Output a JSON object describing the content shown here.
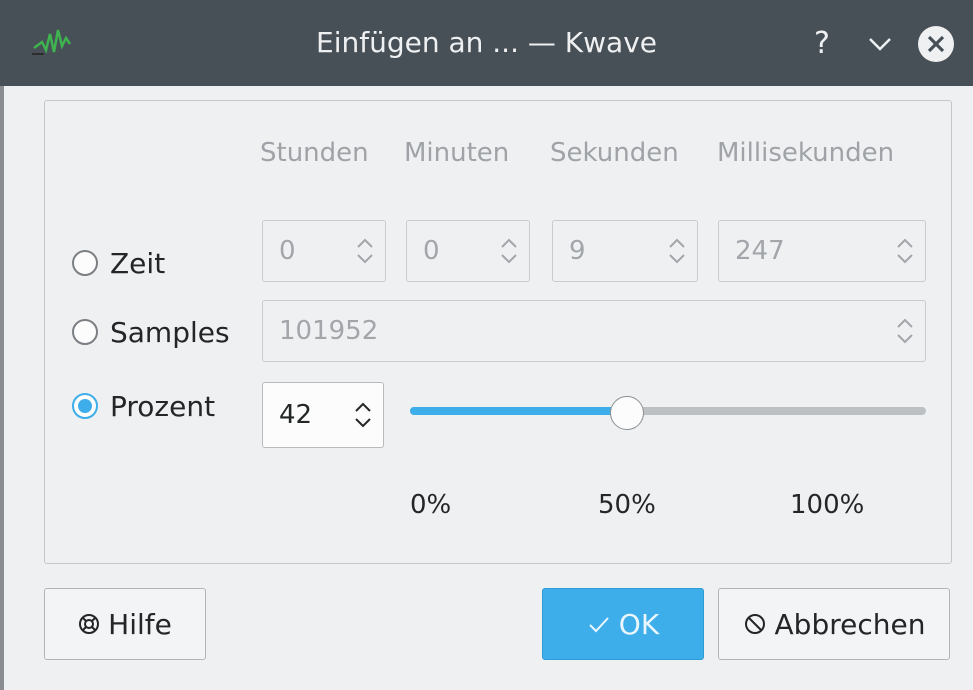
{
  "window": {
    "title": "Einfügen an ... — Kwave",
    "help_glyph": "?",
    "icons": {
      "app": "kwave-waveform-icon",
      "help": "help-icon",
      "minimize": "chevron-down-icon",
      "close": "close-icon"
    }
  },
  "columns": [
    "Stunden",
    "Minuten",
    "Sekunden",
    "Millisekunden"
  ],
  "modes": [
    {
      "label": "Zeit",
      "checked": false
    },
    {
      "label": "Samples",
      "checked": false
    },
    {
      "label": "Prozent",
      "checked": true
    }
  ],
  "time": {
    "hours": "0",
    "minutes": "0",
    "seconds": "9",
    "milliseconds": "247"
  },
  "samples": {
    "value": "101952"
  },
  "percent": {
    "value": "42",
    "slider_fraction": 0.42
  },
  "slider_ticks": [
    "0%",
    "50%",
    "100%"
  ],
  "buttons": {
    "help": {
      "label": "Hilfe",
      "icon": "lifebuoy-icon"
    },
    "ok": {
      "label": "OK",
      "icon": "checkmark-icon"
    },
    "cancel": {
      "label": "Abbrechen",
      "icon": "cancel-icon"
    }
  },
  "colors": {
    "accent": "#3daee9",
    "titlebar": "#475057",
    "window_bg": "#eff0f1"
  }
}
